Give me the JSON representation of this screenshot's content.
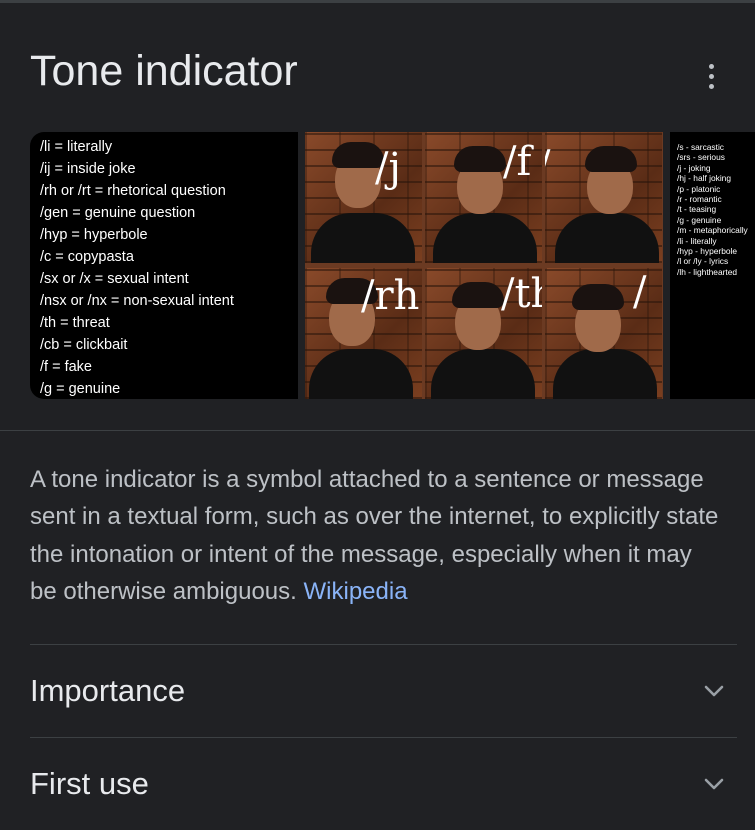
{
  "panel": {
    "title": "Tone indicator",
    "more_icon": "more-vert-icon"
  },
  "images": {
    "list_image": {
      "items": [
        "/li = literally",
        "/ij = inside joke",
        "/rh or /rt = rhetorical question",
        "/gen = genuine question",
        "/hyp = hyperbole",
        "/c = copypasta",
        "/sx or /x = sexual intent",
        "/nsx or /nx = non-sexual intent",
        "/th = threat",
        "/cb = clickbait",
        "/f = fake",
        "/g = genuine"
      ]
    },
    "collage_image": {
      "tags": [
        "/j",
        "/f",
        "/",
        "/rh",
        "/th",
        "/"
      ]
    },
    "small_list_image": {
      "items": [
        "/s - sarcastic",
        "/srs - serious",
        "/j - joking",
        "/hj - half joking",
        "/p - platonic",
        "/r - romantic",
        "/t - teasing",
        "/g - genuine",
        "/m - metaphorically",
        "/li - literally",
        "/hyp - hyperbole",
        "/l or /ly - lyrics",
        "/lh - lighthearted"
      ]
    }
  },
  "description": {
    "text": "A tone indicator is a symbol attached to a sentence or message sent in a textual form, such as over the internet, to explicitly state the intonation or intent of the message, especially when it may be otherwise ambiguous. ",
    "source_link": "Wikipedia"
  },
  "accordions": [
    {
      "label": "Importance",
      "icon": "chevron-down-icon"
    },
    {
      "label": "First use",
      "icon": "chevron-down-icon"
    }
  ],
  "colors": {
    "background": "#202124",
    "title": "#e8eaed",
    "body_text": "#bdc1c6",
    "link": "#8ab4f8",
    "divider": "#3c4043"
  }
}
